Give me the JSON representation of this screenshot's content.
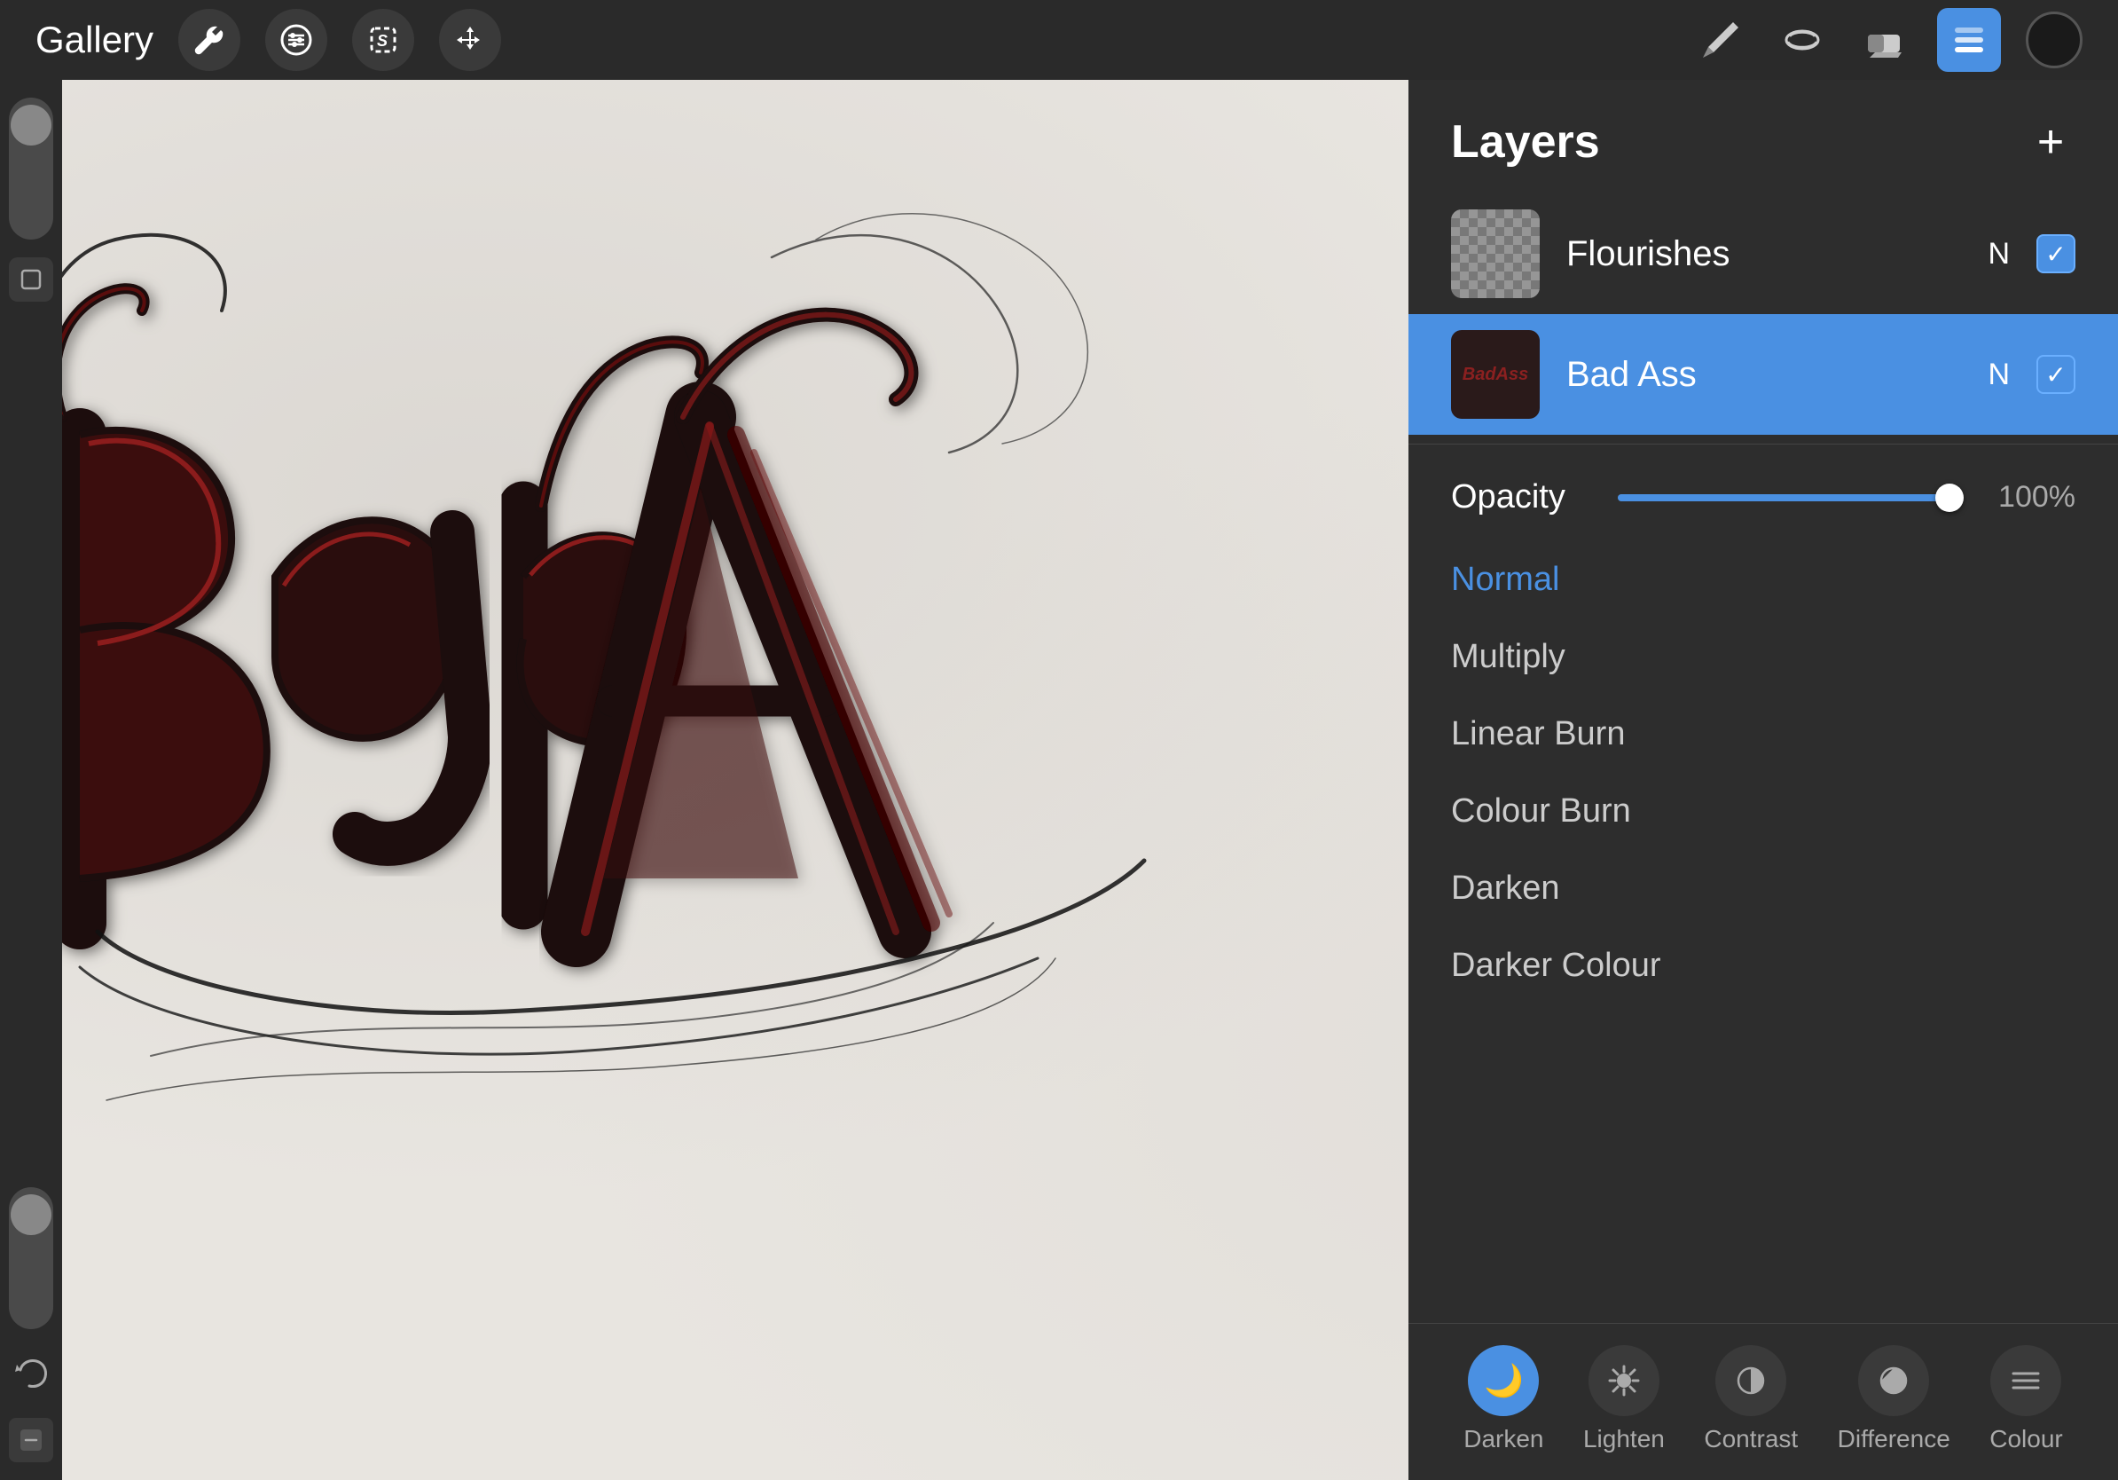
{
  "toolbar": {
    "gallery_label": "Gallery",
    "tools_right": [
      "pencil",
      "smudge",
      "eraser",
      "layers",
      "color"
    ],
    "layers_active": true
  },
  "layers_panel": {
    "title": "Layers",
    "add_button": "+",
    "layers": [
      {
        "id": "flourishes",
        "name": "Flourishes",
        "blend": "N",
        "visible": true,
        "active": false,
        "thumb_type": "checker"
      },
      {
        "id": "bad-ass",
        "name": "Bad Ass",
        "blend": "N",
        "visible": true,
        "active": true,
        "thumb_type": "badass"
      }
    ],
    "opacity": {
      "label": "Opacity",
      "value": 100,
      "value_display": "100%",
      "slider_percent": 100
    },
    "blend_modes": [
      {
        "id": "normal",
        "label": "Normal",
        "active": true
      },
      {
        "id": "multiply",
        "label": "Multiply",
        "active": false
      },
      {
        "id": "linear-burn",
        "label": "Linear Burn",
        "active": false
      },
      {
        "id": "colour-burn",
        "label": "Colour Burn",
        "active": false
      },
      {
        "id": "darken",
        "label": "Darken",
        "active": false
      },
      {
        "id": "darker-colour",
        "label": "Darker Colour",
        "active": false
      }
    ],
    "bottom_icons": [
      {
        "id": "darken-icon",
        "label": "Darken",
        "active": true,
        "symbol": "🌙"
      },
      {
        "id": "lighten-icon",
        "label": "Lighten",
        "active": false,
        "symbol": "✦"
      },
      {
        "id": "contrast-icon",
        "label": "Contrast",
        "active": false,
        "symbol": "◑"
      },
      {
        "id": "difference-icon",
        "label": "Difference",
        "active": false,
        "symbol": "◕"
      },
      {
        "id": "colour-icon",
        "label": "Colour",
        "active": false,
        "symbol": "☰"
      }
    ]
  }
}
